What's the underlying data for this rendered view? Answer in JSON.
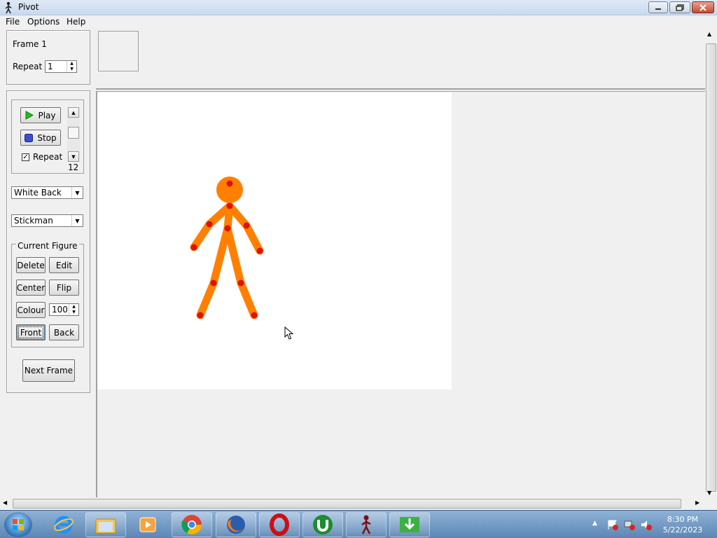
{
  "window": {
    "title": "Pivot"
  },
  "menu": {
    "file": "File",
    "options": "Options",
    "help": "Help"
  },
  "frame_panel": {
    "frame_label": "Frame 1",
    "repeat_label": "Repeat :",
    "repeat_value": "1"
  },
  "playback": {
    "play": "Play",
    "stop": "Stop",
    "repeat": "Repeat",
    "repeat_checked": true,
    "speed_value": "12"
  },
  "background_select": {
    "value": "White Back"
  },
  "figure_type_select": {
    "value": "Stickman"
  },
  "current_figure": {
    "title": "Current Figure",
    "delete": "Delete",
    "edit": "Edit",
    "center": "Center",
    "flip": "Flip",
    "colour": "Colour",
    "colour_value": "100",
    "front": "Front",
    "back": "Back"
  },
  "next_frame": "Next Frame",
  "figure": {
    "color": "#ff8000",
    "joint_color": "#e01010"
  },
  "taskbar": {
    "apps": [
      "internet-explorer-icon",
      "file-explorer-icon",
      "media-player-icon",
      "chrome-icon",
      "firefox-icon",
      "opera-icon",
      "utorrent-icon",
      "pivot-icon",
      "download-icon"
    ],
    "time": "8:30 PM",
    "date": "5/22/2023"
  }
}
